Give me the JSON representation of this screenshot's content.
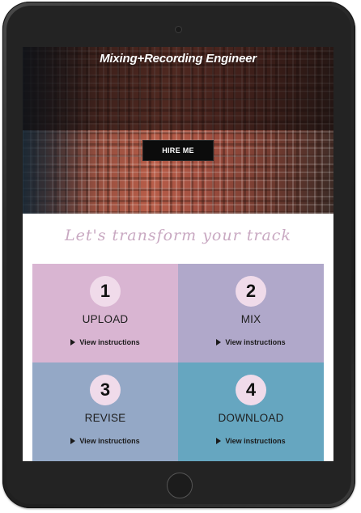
{
  "site": {
    "title": "Mixing+Recording Engineer",
    "hire_button": "HIRE ME",
    "tagline": "Let's transform your track"
  },
  "steps": [
    {
      "number": "1",
      "label": "UPLOAD",
      "link": "View instructions",
      "color": "#d9b5d2"
    },
    {
      "number": "2",
      "label": "MIX",
      "link": "View instructions",
      "color": "#b0a8ca"
    },
    {
      "number": "3",
      "label": "REVISE",
      "link": "View instructions",
      "color": "#94a8c6"
    },
    {
      "number": "4",
      "label": "DOWNLOAD",
      "link": "View instructions",
      "color": "#66a6c0"
    }
  ]
}
